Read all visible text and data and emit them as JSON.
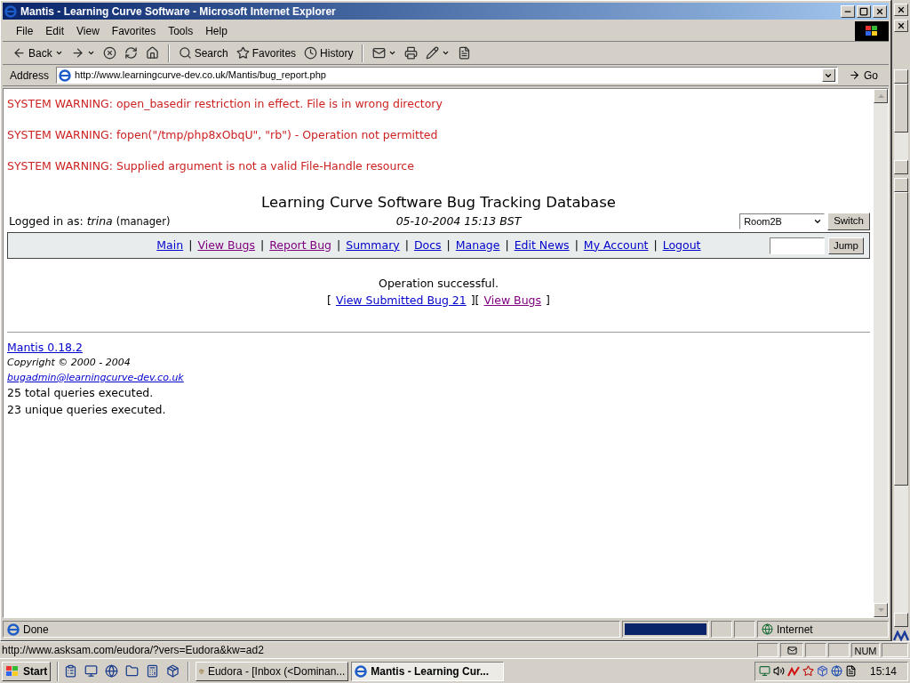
{
  "window": {
    "title": "Mantis - Learning Curve Software - Microsoft Internet Explorer"
  },
  "menu": [
    "File",
    "Edit",
    "View",
    "Favorites",
    "Tools",
    "Help"
  ],
  "toolbar": [
    {
      "kind": "back",
      "label": "Back"
    },
    {
      "kind": "forward"
    },
    {
      "kind": "stop"
    },
    {
      "kind": "refresh"
    },
    {
      "kind": "home"
    },
    {
      "kind": "search",
      "label": "Search"
    },
    {
      "kind": "favorites",
      "label": "Favorites"
    },
    {
      "kind": "history",
      "label": "History"
    },
    {
      "kind": "mail"
    },
    {
      "kind": "print"
    },
    {
      "kind": "edit"
    },
    {
      "kind": "discuss"
    }
  ],
  "address": {
    "label": "Address",
    "value": "http://www.learningcurve-dev.co.uk/Mantis/bug_report.php",
    "go": "Go"
  },
  "warnings": [
    "SYSTEM WARNING: open_basedir restriction in effect. File is in wrong directory",
    "SYSTEM WARNING: fopen(\"/tmp/php8xObqU\", \"rb\") - Operation not permitted",
    "SYSTEM WARNING: Supplied argument is not a valid File-Handle resource"
  ],
  "page": {
    "heading": "Learning Curve Software Bug Tracking Database",
    "logged_in_label": "Logged in as:",
    "user": "trina",
    "role": "(manager)",
    "datetime": "05-10-2004 15:13 BST",
    "project": "Room2B",
    "switch": "Switch",
    "jump": "Jump"
  },
  "nav": [
    {
      "kind": "link",
      "text": "Main",
      "visited": false
    },
    {
      "kind": "sep",
      "text": "|"
    },
    {
      "kind": "link",
      "text": "View Bugs",
      "visited": true
    },
    {
      "kind": "sep",
      "text": "|"
    },
    {
      "kind": "link",
      "text": "Report Bug",
      "visited": true
    },
    {
      "kind": "sep",
      "text": "|"
    },
    {
      "kind": "link",
      "text": "Summary",
      "visited": false
    },
    {
      "kind": "sep",
      "text": "|"
    },
    {
      "kind": "link",
      "text": "Docs",
      "visited": false
    },
    {
      "kind": "sep",
      "text": "|"
    },
    {
      "kind": "link",
      "text": "Manage",
      "visited": false
    },
    {
      "kind": "sep",
      "text": "|"
    },
    {
      "kind": "link",
      "text": "Edit News",
      "visited": false
    },
    {
      "kind": "sep",
      "text": "|"
    },
    {
      "kind": "link",
      "text": "My Account",
      "visited": false
    },
    {
      "kind": "sep",
      "text": "|"
    },
    {
      "kind": "link",
      "text": "Logout",
      "visited": false
    }
  ],
  "result": {
    "message": "Operation successful.",
    "parts": [
      {
        "kind": "text",
        "text": "["
      },
      {
        "kind": "link",
        "text": "View Submitted Bug 21",
        "visited": false
      },
      {
        "kind": "text",
        "text": "]["
      },
      {
        "kind": "link",
        "text": "View Bugs",
        "visited": true
      },
      {
        "kind": "text",
        "text": "]"
      }
    ]
  },
  "footer": {
    "version": "Mantis 0.18.2",
    "copyright": "Copyright © 2000 - 2004",
    "email": "bugadmin@learningcurve-dev.co.uk",
    "lines": [
      "25 total queries executed.",
      "23 unique queries executed."
    ]
  },
  "status": {
    "text": "Done",
    "level": 1,
    "zone": "Internet"
  },
  "eudora_status": {
    "url": "http://www.asksam.com/eudora/?vers=Eudora&kw=ad2",
    "indicator": "NUM"
  },
  "taskbar": {
    "start": "Start",
    "tasks": [
      {
        "label": "Eudora - [Inbox (<Dominan...",
        "selected": false
      },
      {
        "label": "Mantis - Learning Cur...",
        "selected": true
      }
    ],
    "clock": "15:14"
  }
}
